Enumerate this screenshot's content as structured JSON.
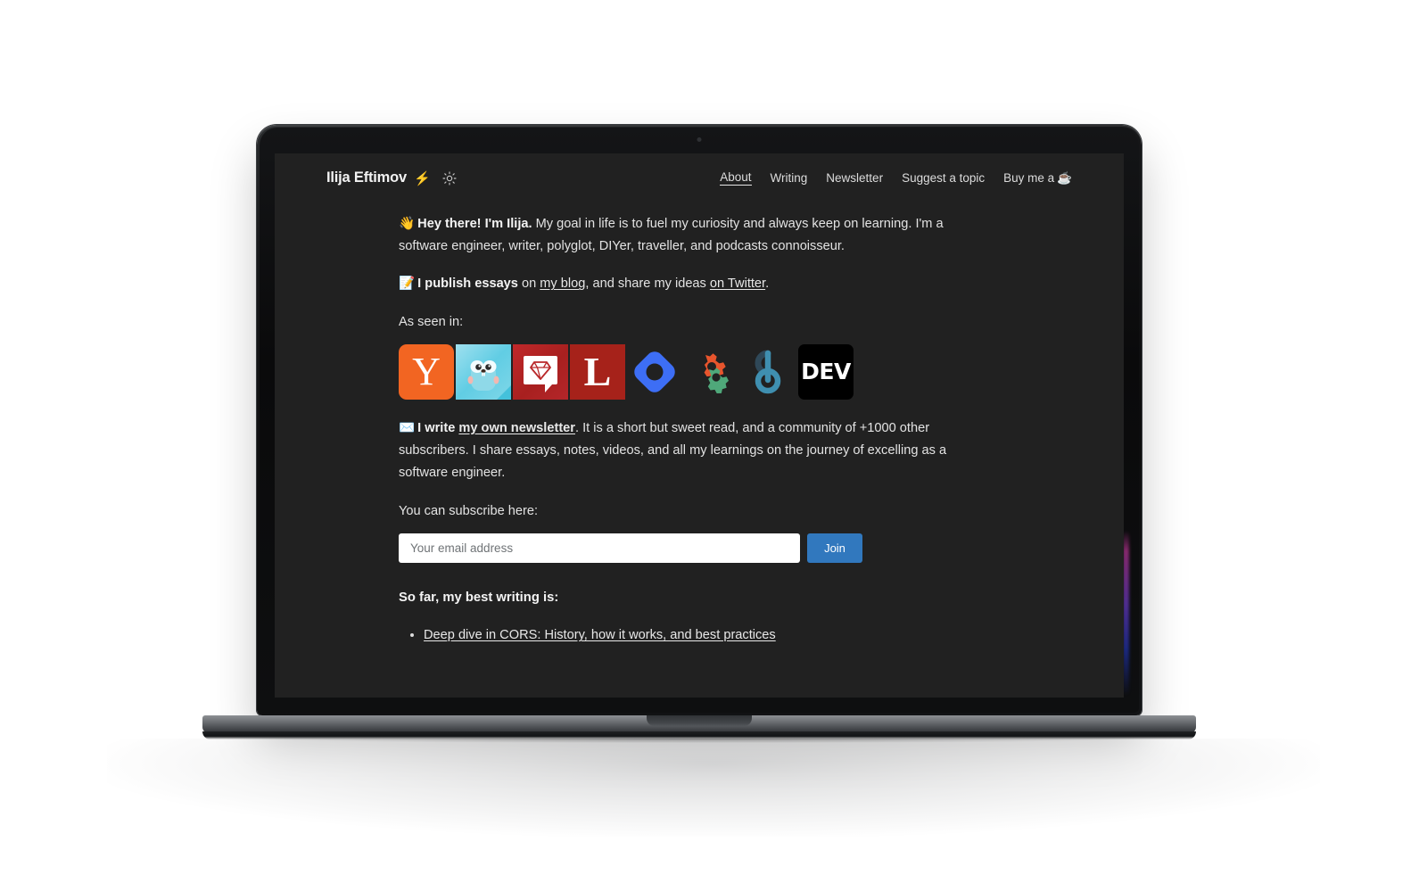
{
  "site": {
    "brand": {
      "name": "Ilija Eftimov",
      "bolt": "⚡",
      "theme_toggle_icon": "sun-icon"
    },
    "nav": [
      {
        "label": "About",
        "active": true
      },
      {
        "label": "Writing",
        "active": false
      },
      {
        "label": "Newsletter",
        "active": false
      },
      {
        "label": "Suggest a topic",
        "active": false
      },
      {
        "label": "Buy me a",
        "coffee": "☕",
        "active": false
      }
    ],
    "intro": {
      "emoji": "👋",
      "lead": "Hey there! I'm Ilija.",
      "body": " My goal in life is to fuel my curiosity and always keep on learning. I'm a software engineer, writer, polyglot, DIYer, traveller, and podcasts connoisseur."
    },
    "essays": {
      "emoji": "📝",
      "lead": "I publish essays",
      "mid_1": " on ",
      "link_blog": "my blog",
      "mid_2": ", and share my ideas ",
      "link_twitter": "on Twitter",
      "tail": "."
    },
    "as_seen_in_label": "As seen in:",
    "logos": [
      {
        "name": "hacker-news",
        "text": "Y"
      },
      {
        "name": "golang-weekly",
        "text": ""
      },
      {
        "name": "ruby-weekly",
        "text": ""
      },
      {
        "name": "lobsters",
        "text": "L"
      },
      {
        "name": "google-developers",
        "text": ""
      },
      {
        "name": "devops-gears",
        "text": ""
      },
      {
        "name": "codeburst",
        "text": ""
      },
      {
        "name": "dev-to",
        "text": "DEV"
      }
    ],
    "newsletter": {
      "emoji": "✉️",
      "lead": "I write ",
      "link": "my own newsletter",
      "body": ". It is a short but sweet read, and a community of +1000 other subscribers. I share essays, notes, videos, and all my learnings on the journey of excelling as a software engineer."
    },
    "subscribe": {
      "label": "You can subscribe here:",
      "placeholder": "Your email address",
      "value": "",
      "button": "Join"
    },
    "best_writing": {
      "heading": "So far, my best writing is:",
      "items": [
        "Deep dive in CORS: History, how it works, and best practices"
      ]
    },
    "colors": {
      "page_bg": "#212121",
      "accent_blue": "#3178be",
      "text": "#e3e3e3",
      "hacker_news_orange": "#f26522",
      "ruby_red": "#b9282a",
      "lobsters_red": "#a6221a",
      "dev_black": "#000000"
    }
  }
}
